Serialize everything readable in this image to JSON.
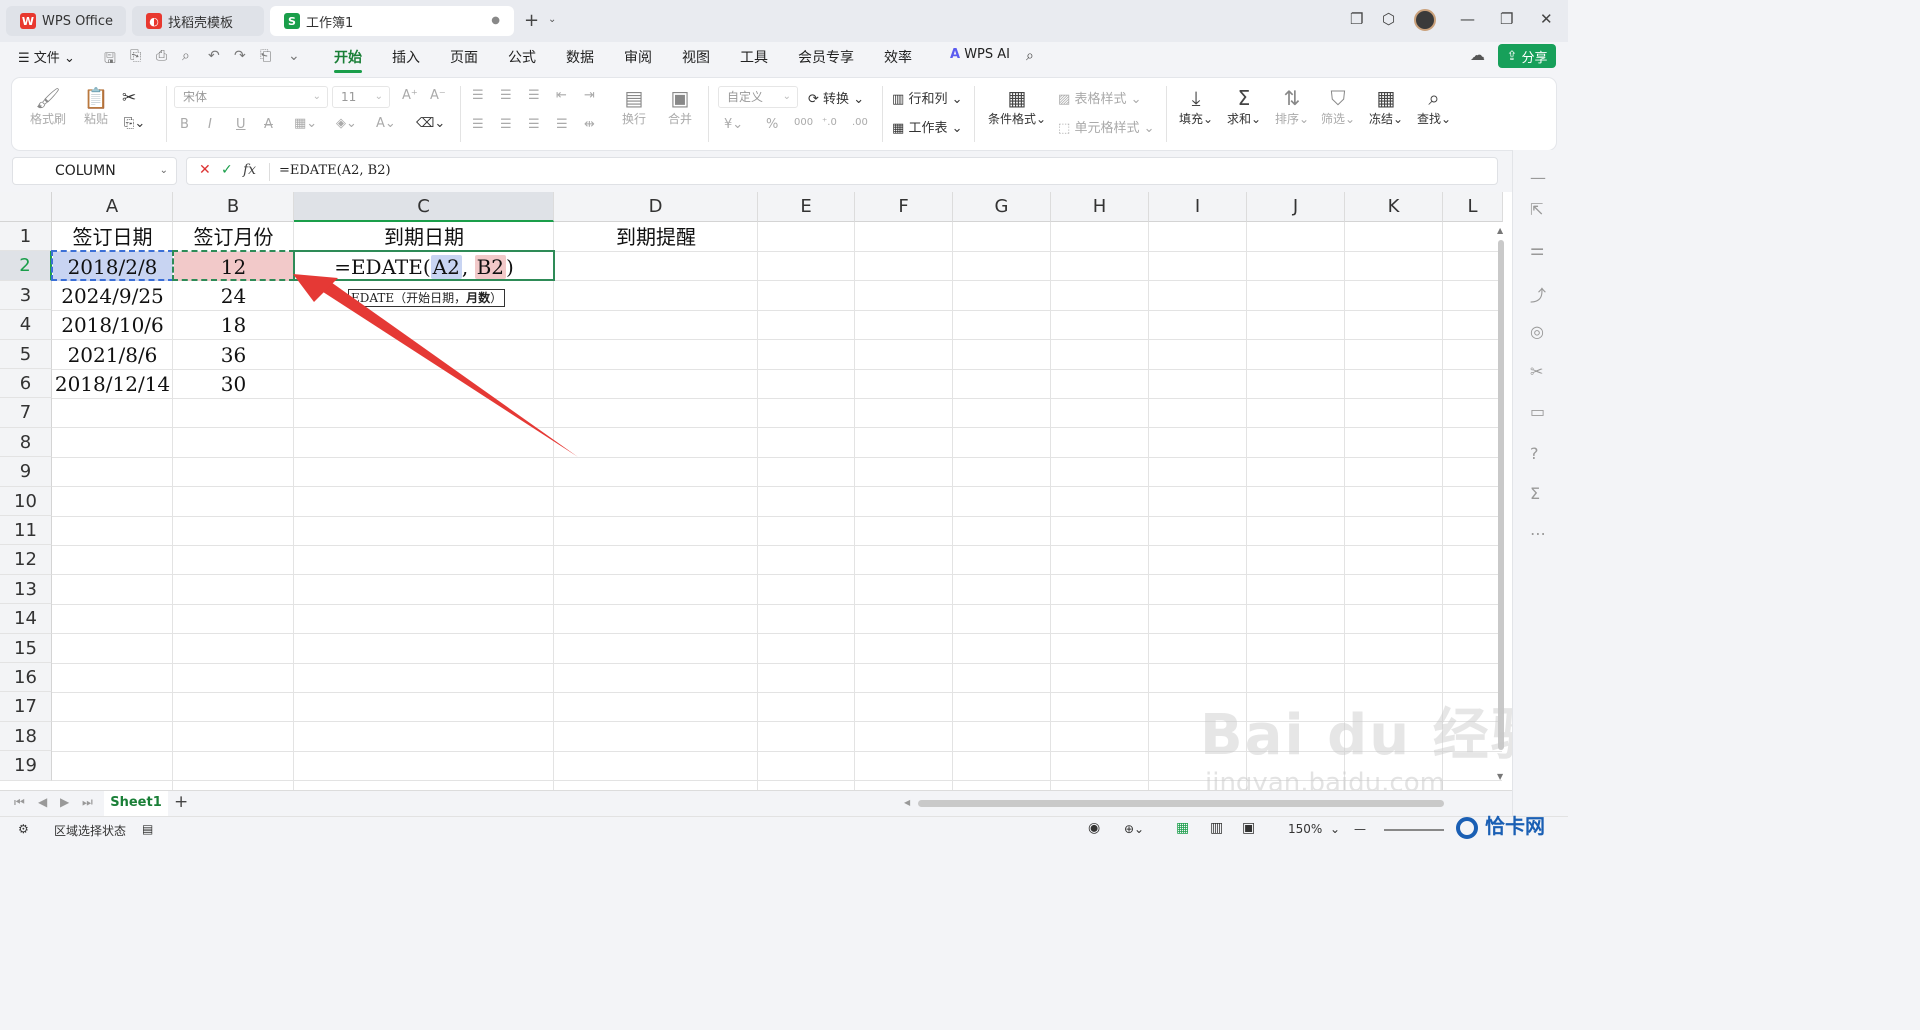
{
  "tabs": [
    {
      "label": "WPS Office"
    },
    {
      "label": "找稻壳模板"
    },
    {
      "label": "工作簿1"
    }
  ],
  "menu": {
    "file": "文件",
    "items": [
      "开始",
      "插入",
      "页面",
      "公式",
      "数据",
      "审阅",
      "视图",
      "工具",
      "会员专享",
      "效率"
    ],
    "wps_ai": "WPS AI",
    "share": "分享"
  },
  "ribbon": {
    "format_painter": "格式刷",
    "paste": "粘贴",
    "font_name": "宋体",
    "font_size": "11",
    "wrap": "换行",
    "merge": "合并",
    "number_format": "自定义",
    "convert": "转换",
    "rows_cols": "行和列",
    "worksheet": "工作表",
    "conditional_format": "条件格式",
    "table_style": "表格样式",
    "cell_style": "单元格样式",
    "fill": "填充",
    "sum": "求和",
    "sort": "排序",
    "filter": "筛选",
    "freeze": "冻结",
    "find": "查找"
  },
  "formula_bar": {
    "name_box": "COLUMN",
    "formula": "=EDATE(A2, B2)"
  },
  "columns": [
    "A",
    "B",
    "C",
    "D",
    "E",
    "F",
    "G",
    "H",
    "I",
    "J",
    "K",
    "L"
  ],
  "rows": [
    "1",
    "2",
    "3",
    "4",
    "5",
    "6",
    "7",
    "8",
    "9",
    "10",
    "11",
    "12",
    "13",
    "14",
    "15",
    "16",
    "17",
    "18",
    "19"
  ],
  "cells": {
    "A1": "签订日期",
    "B1": "签订月份",
    "C1": "到期日期",
    "D1": "到期提醒",
    "A2": "2018/2/8",
    "B2": "12",
    "A3": "2024/9/25",
    "B3": "24",
    "A4": "2018/10/6",
    "B4": "18",
    "A5": "2021/8/6",
    "B5": "36",
    "A6": "2018/12/14",
    "B6": "30"
  },
  "edit": {
    "prefix": "=EDATE(",
    "ref1": "A2",
    "comma": ",",
    "ref2": "B2",
    "suffix": ")"
  },
  "tooltip": {
    "fn": "EDATE（开始日期，",
    "bold": "月数",
    "close": "）"
  },
  "sheet": {
    "name": "Sheet1"
  },
  "status": {
    "mode": "区域选择状态",
    "zoom": "150%"
  },
  "watermark": {
    "main": "Bai du 经验",
    "sub": "jingyan.baidu.com",
    "corner": "恰卡网"
  },
  "colors": {
    "accent": "#1a9e4a",
    "ref_a2": "#c8d4f2",
    "ref_b2": "#f2c9c9",
    "arrow": "#e53935"
  }
}
